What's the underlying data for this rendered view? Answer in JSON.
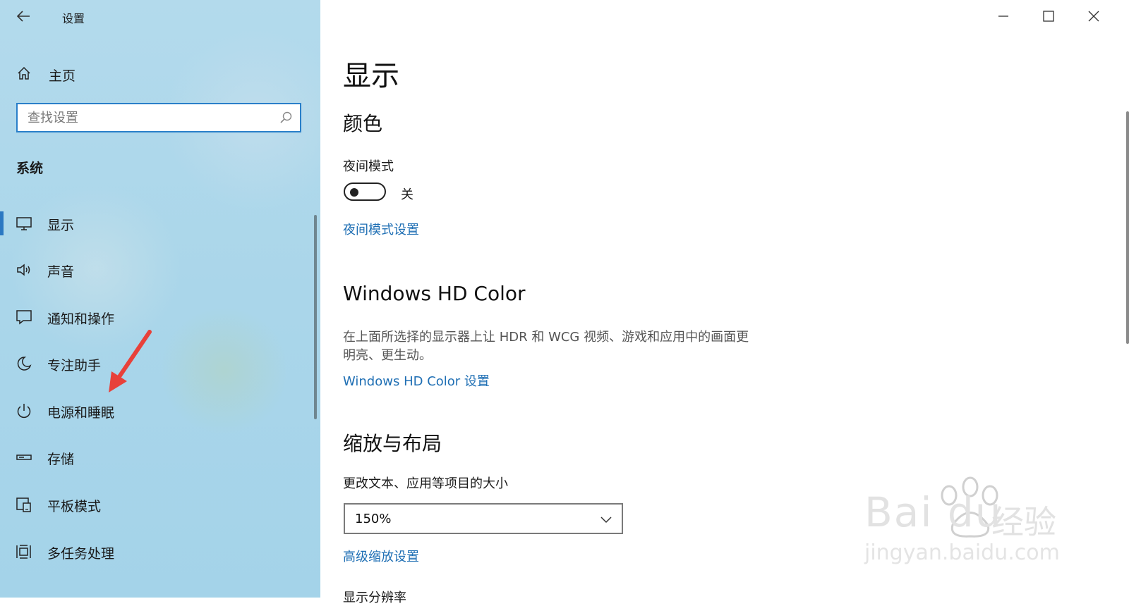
{
  "app": {
    "title": "设置"
  },
  "sidebar": {
    "home_label": "主页",
    "search_placeholder": "查找设置",
    "section_label": "系统",
    "items": [
      {
        "label": "显示",
        "icon": "monitor-icon",
        "active": true
      },
      {
        "label": "声音",
        "icon": "speaker-icon"
      },
      {
        "label": "通知和操作",
        "icon": "notification-icon"
      },
      {
        "label": "专注助手",
        "icon": "moon-icon"
      },
      {
        "label": "电源和睡眠",
        "icon": "power-icon"
      },
      {
        "label": "存储",
        "icon": "storage-icon"
      },
      {
        "label": "平板模式",
        "icon": "tablet-icon"
      },
      {
        "label": "多任务处理",
        "icon": "multitask-icon"
      }
    ]
  },
  "main": {
    "title": "显示",
    "color_section": {
      "heading": "颜色",
      "night_mode_label": "夜间模式",
      "night_mode_state": "关",
      "night_mode_on": false,
      "night_mode_link": "夜间模式设置"
    },
    "hdr_section": {
      "heading": "Windows HD Color",
      "description_line1": "在上面所选择的显示器上让 HDR 和 WCG 视频、游戏和应用中的画面更",
      "description_line2": "明亮、更生动。",
      "link": "Windows HD Color 设置"
    },
    "scale_section": {
      "heading": "缩放与布局",
      "text_size_label": "更改文本、应用等项目的大小",
      "text_size_value": "150%",
      "advanced_link": "高级缩放设置",
      "resolution_label": "显示分辨率"
    }
  },
  "watermark": {
    "brand": "Bai du",
    "brand_suffix": "经验",
    "url": "jingyan.baidu.com"
  },
  "colors": {
    "accent": "#2b78c2",
    "link": "#1f6fb4",
    "annotation": "#e8413a"
  }
}
